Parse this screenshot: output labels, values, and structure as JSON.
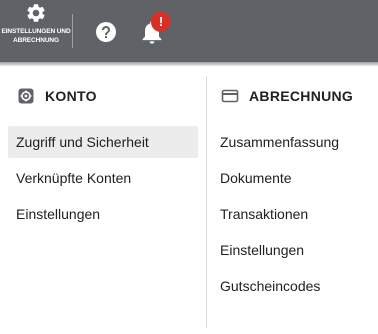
{
  "topbar": {
    "settings_label": "EINSTELLUNGEN UND ABRECHNUNG",
    "settings_icon": "gear-icon",
    "help_icon": "help-circle-icon",
    "notifications_icon": "bell-icon",
    "notification_badge": "!",
    "background_color": "#5f6368",
    "badge_color": "#d93025"
  },
  "konto": {
    "header": "KONTO",
    "icon": "account-settings-icon",
    "items": [
      {
        "label": "Zugriff und Sicherheit",
        "selected": true
      },
      {
        "label": "Verknüpfte Konten",
        "selected": false
      },
      {
        "label": "Einstellungen",
        "selected": false
      }
    ]
  },
  "abrechnung": {
    "header": "ABRECHNUNG",
    "icon": "credit-card-icon",
    "items": [
      {
        "label": "Zusammenfassung"
      },
      {
        "label": "Dokumente"
      },
      {
        "label": "Transaktionen"
      },
      {
        "label": "Einstellungen"
      },
      {
        "label": "Gutscheincodes"
      }
    ]
  }
}
